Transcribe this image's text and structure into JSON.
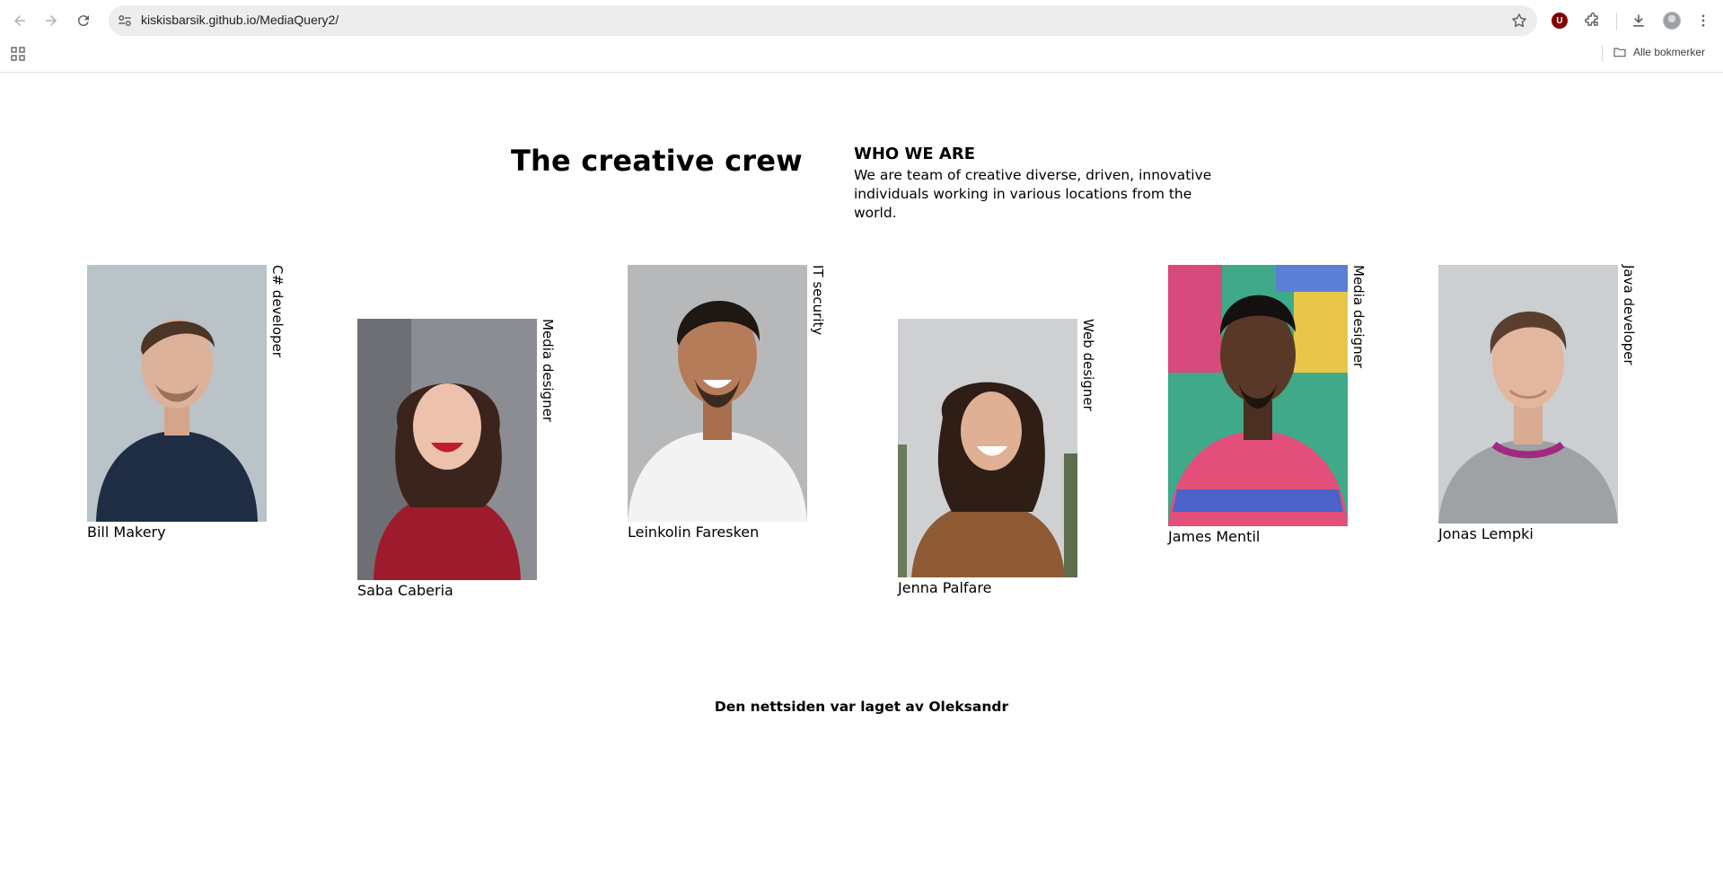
{
  "browser": {
    "url": "kiskisbarsik.github.io/MediaQuery2/",
    "bookmarks_label": "Alle bokmerker",
    "extension_badge": "U"
  },
  "page": {
    "title": "The creative crew",
    "who_title": "WHO WE ARE",
    "who_text": "We are team of creative diverse, driven, innovative individuals working in various locations from the world."
  },
  "team": [
    {
      "name": "Bill Makery",
      "role": "C# developer",
      "photo": "portrait-man-light-background"
    },
    {
      "name": "Saba Caberia",
      "role": "Media designer",
      "photo": "portrait-woman-red-top"
    },
    {
      "name": "Leinkolin Faresken",
      "role": "IT security",
      "photo": "portrait-man-white-tshirt"
    },
    {
      "name": "Jenna Palfare",
      "role": "Web designer",
      "photo": "portrait-woman-palm-trees"
    },
    {
      "name": "James Mentil",
      "role": "Media designer",
      "photo": "portrait-man-graffiti-wall"
    },
    {
      "name": "Jonas Lempki",
      "role": "Java developer",
      "photo": "portrait-man-grey-sweater"
    }
  ],
  "footer": "Den nettsiden var laget av Oleksandr",
  "colors": {
    "omnibox_bg": "#ededed",
    "extension_red": "#800000",
    "text": "#000000"
  }
}
